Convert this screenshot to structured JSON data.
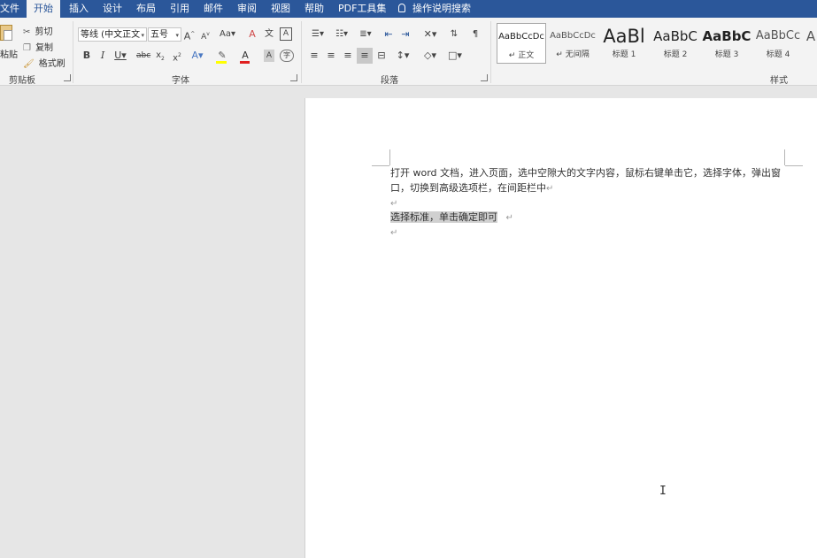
{
  "tabs": [
    "文件",
    "开始",
    "插入",
    "设计",
    "布局",
    "引用",
    "邮件",
    "审阅",
    "视图",
    "帮助",
    "PDF工具集"
  ],
  "tell_me": "操作说明搜索",
  "clipboard": {
    "paste": "粘贴",
    "cut": "剪切",
    "copy": "复制",
    "format_painter": "格式刷",
    "group": "剪贴板"
  },
  "font": {
    "name": "等线 (中文正文",
    "size": "五号",
    "group": "字体"
  },
  "paragraph": {
    "group": "段落"
  },
  "styles": {
    "group": "样式",
    "items": [
      {
        "preview": "AaBbCcDc",
        "name": "正文",
        "mark": "↵"
      },
      {
        "preview": "AaBbCcDc",
        "name": "无间隔",
        "mark": "↵"
      },
      {
        "preview": "AaBl",
        "name": "标题 1"
      },
      {
        "preview": "AaBbC",
        "name": "标题 2"
      },
      {
        "preview": "AaBbC",
        "name": "标题 3"
      },
      {
        "preview": "AaBbCc",
        "name": "标题 4"
      },
      {
        "preview": "A",
        "name": ""
      }
    ]
  },
  "document": {
    "line1": "打开 word 文档，进入页面，选中空隙大的文字内容，鼠标右键单击它，选择字体，弹出窗",
    "line2": "口，切换到高级选项栏，在间距栏中",
    "selected": "选择标准，单击确定即可",
    "para_mark": "↵"
  },
  "icons": [
    "cut-icon",
    "copy-icon",
    "format-painter-icon",
    "lightbulb-icon",
    "i-beam-cursor-icon"
  ]
}
